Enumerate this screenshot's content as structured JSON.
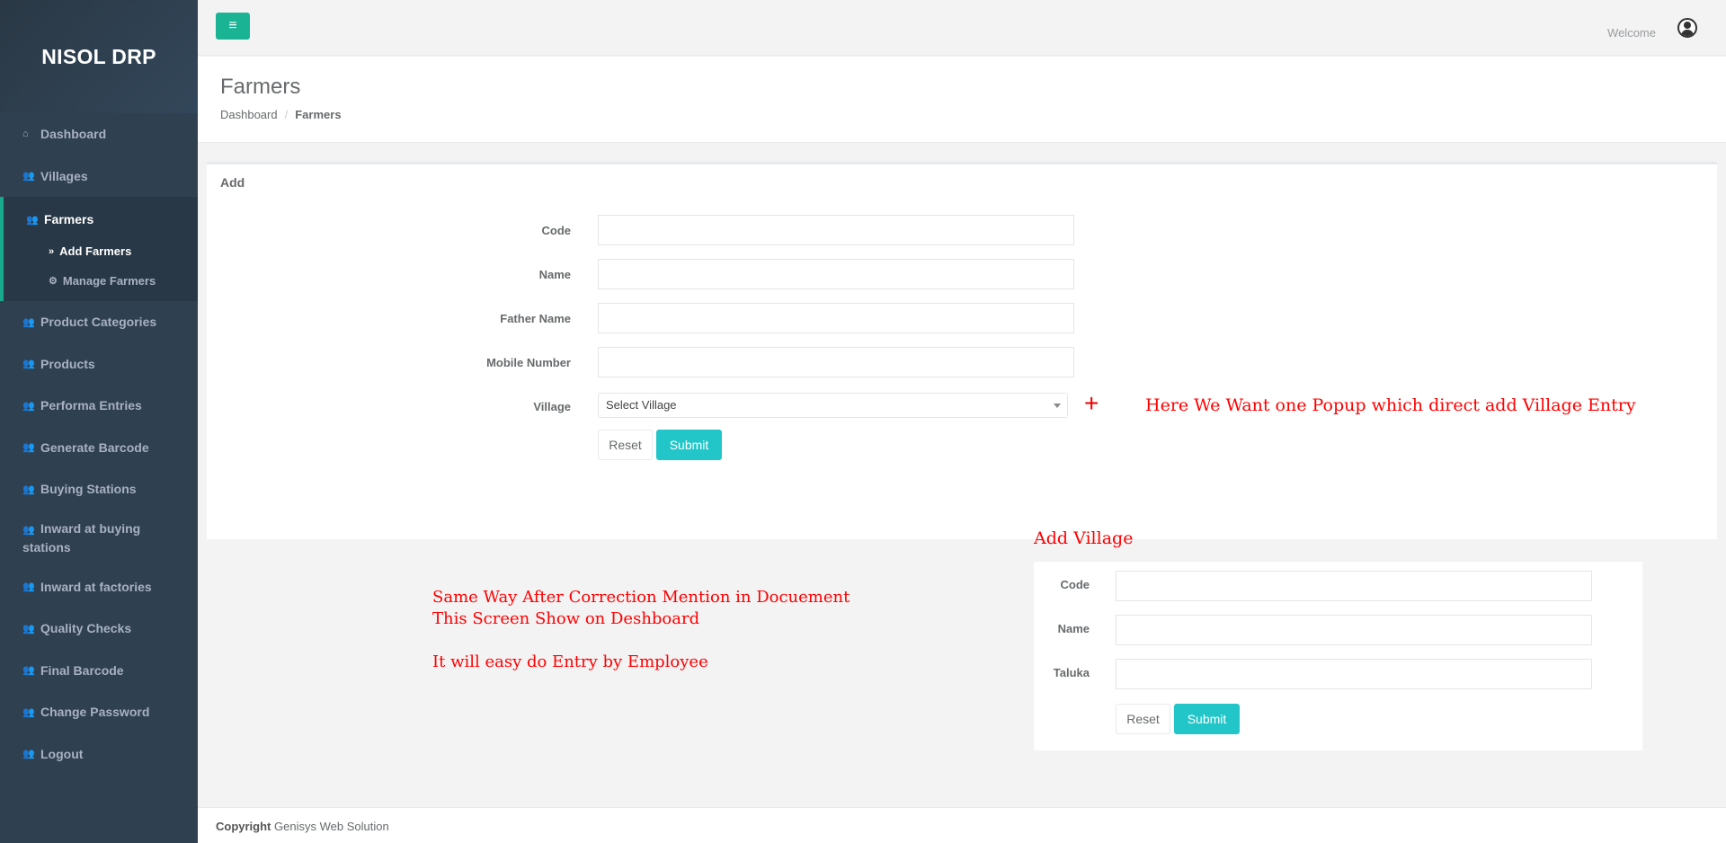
{
  "app": {
    "brand": "NISOL DRP"
  },
  "sidebar": {
    "items_top": [
      {
        "label": "Dashboard",
        "icon": "home-icon"
      },
      {
        "label": "Villages",
        "icon": "users-icon"
      }
    ],
    "active": {
      "label": "Farmers",
      "icon": "users-icon",
      "children": [
        {
          "label": "Add Farmers",
          "icon": "double-chevron-right-icon",
          "current": true
        },
        {
          "label": "Manage Farmers",
          "icon": "gear-icon",
          "current": false
        }
      ]
    },
    "items_bottom": [
      {
        "label": "Product Categories",
        "icon": "users-icon"
      },
      {
        "label": "Products",
        "icon": "users-icon"
      },
      {
        "label": "Performa Entries",
        "icon": "users-icon"
      },
      {
        "label": "Generate Barcode",
        "icon": "users-icon"
      },
      {
        "label": "Buying Stations",
        "icon": "users-icon"
      },
      {
        "label": "Inward at buying stations",
        "icon": "users-icon"
      },
      {
        "label": "Inward at factories",
        "icon": "users-icon"
      },
      {
        "label": "Quality Checks",
        "icon": "users-icon"
      },
      {
        "label": "Final Barcode",
        "icon": "users-icon"
      },
      {
        "label": "Change Password",
        "icon": "users-icon"
      },
      {
        "label": "Logout",
        "icon": "users-icon"
      }
    ]
  },
  "topbar": {
    "menu_icon": "hamburger-icon",
    "welcome": "Welcome",
    "user_icon": "user-circle-icon"
  },
  "page": {
    "title": "Farmers",
    "breadcrumb": {
      "home": "Dashboard",
      "separator": "/",
      "current": "Farmers"
    }
  },
  "farmer_form": {
    "title": "Add",
    "fields": {
      "code": {
        "label": "Code",
        "value": ""
      },
      "name": {
        "label": "Name",
        "value": ""
      },
      "father_name": {
        "label": "Father Name",
        "value": ""
      },
      "mobile": {
        "label": "Mobile Number",
        "value": ""
      },
      "village": {
        "label": "Village",
        "selected": "Select Village"
      }
    },
    "add_village_icon": "+",
    "reset_label": "Reset",
    "submit_label": "Submit"
  },
  "annotations": {
    "popup_note": "Here We Want one Popup which direct add Village Entry",
    "add_village_title": "Add Village",
    "line1": "Same Way After Correction Mention in Docuement",
    "line2": "This Screen Show on Deshboard",
    "line3": "It will easy do Entry by Employee"
  },
  "village_form": {
    "fields": {
      "code": {
        "label": "Code",
        "value": ""
      },
      "name": {
        "label": "Name",
        "value": ""
      },
      "taluka": {
        "label": "Taluka",
        "value": ""
      }
    },
    "reset_label": "Reset",
    "submit_label": "Submit"
  },
  "footer": {
    "copyright_label": "Copyright",
    "company": "Genisys Web Solution"
  },
  "colors": {
    "sidebar_bg": "#2f4050",
    "accent_green": "#1ab394",
    "teal_button": "#23c6c8",
    "annotation_red": "#ff0000"
  }
}
